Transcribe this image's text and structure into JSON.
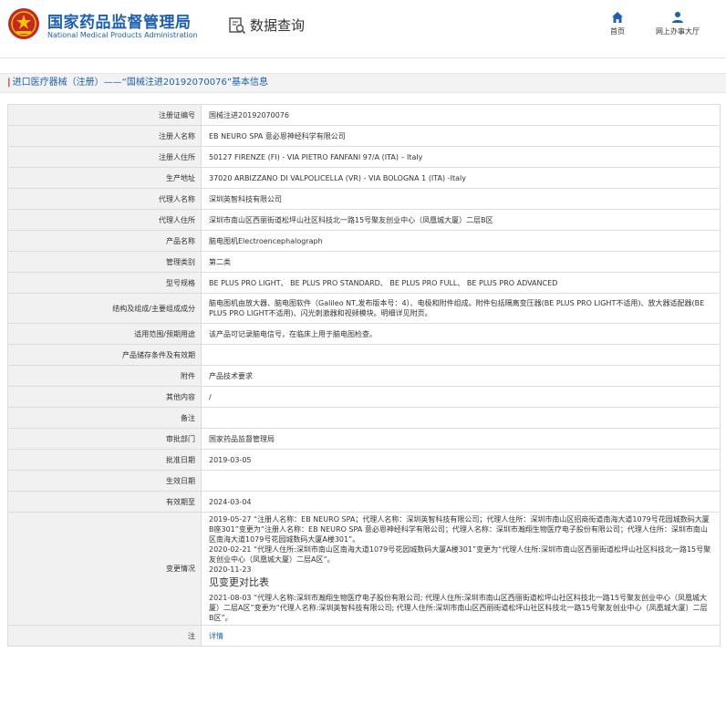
{
  "header": {
    "org_cn": "国家药品监督管理局",
    "org_en": "National Medical Products Administration",
    "query_title": "数据查询",
    "nav": {
      "home": "首页",
      "office": "网上办事大厅"
    },
    "colors": {
      "brand": "#1d5fb0",
      "seal_red": "#c62828"
    }
  },
  "breadcrumb": {
    "text": "进口医疗器械（注册）——“国械注进20192070076”基本信息"
  },
  "rows": [
    {
      "label": "注册证编号",
      "value": "国械注进20192070076"
    },
    {
      "label": "注册人名称",
      "value": "EB NEURO SPA 意必恩神经科学有限公司"
    },
    {
      "label": "注册人住所",
      "value": "50127 FIRENZE (FI) - VIA PIETRO FANFANI 97/A (ITA) – Italy"
    },
    {
      "label": "生产地址",
      "value": "37020 ARBIZZANO DI VALPOLICELLA (VR) - VIA BOLOGNA 1 (ITA) -Italy"
    },
    {
      "label": "代理人名称",
      "value": "深圳英智科技有限公司"
    },
    {
      "label": "代理人住所",
      "value": "深圳市南山区西丽街道松坪山社区科技北一路15号聚友创业中心（凤凰城大厦）二层B区"
    },
    {
      "label": "产品名称",
      "value": "脑电图机Electroencephalograph"
    },
    {
      "label": "管理类别",
      "value": "第二类"
    },
    {
      "label": "型号规格",
      "value": "BE PLUS PRO LIGHT、 BE PLUS PRO STANDARD、 BE PLUS PRO FULL、 BE PLUS PRO ADVANCED"
    },
    {
      "label": "结构及组成/主要组成成分",
      "value": "脑电图机由放大器、脑电图软件（Galileo NT,发布版本号：4）、电极和附件组成。附件包括隔离变压器(BE PLUS PRO LIGHT不适用)、放大器适配器(BE PLUS PRO LIGHT不适用)、闪光刺激器和视频模块。明细详见附页。"
    },
    {
      "label": "适用范围/预期用途",
      "value": "该产品可记录脑电信号，在临床上用于脑电图检查。"
    },
    {
      "label": "产品储存条件及有效期",
      "value": ""
    },
    {
      "label": "附件",
      "value": "产品技术要求"
    },
    {
      "label": "其他内容",
      "value": "/"
    },
    {
      "label": "备注",
      "value": ""
    },
    {
      "label": "审批部门",
      "value": "国家药品监督管理局"
    },
    {
      "label": "批准日期",
      "value": "2019-03-05"
    },
    {
      "label": "生效日期",
      "value": ""
    },
    {
      "label": "有效期至",
      "value": "2024-03-04"
    }
  ],
  "changes": {
    "label": "变更情况",
    "entries": [
      "2019-05-27 “注册人名称：EB NEURO SPA；代理人名称：深圳英智科技有限公司；代理人住所：深圳市南山区招商街道南海大道1079号花园城数码大厦B座301”变更为“注册人名称：EB NEURO SPA 意必恩神经科学有限公司；代理人名称：深圳市瀚翔生物医疗电子股份有限公司；代理人住所：深圳市南山区南海大道1079号花园城数码大厦A楼301”。",
      "2020-02-21 “代理人住所:深圳市南山区南海大道1079号花园城数码大厦A楼301”变更为“代理人住所:深圳市南山区西丽街道松坪山社区科技北一路15号聚友创业中心（凤凰城大厦）二层A区”。",
      "2020-11-23"
    ],
    "see_table": "见变更对比表",
    "last_entry": "2021-08-03 “代理人名称:深圳市瀚翔生物医疗电子股份有限公司; 代理人住所:深圳市南山区西丽街道松坪山社区科技北一路15号聚友创业中心（凤凰城大厦）二层A区”变更为“代理人名称:深圳英智科技有限公司; 代理人住所:深圳市南山区西丽街道松坪山社区科技北一路15号聚友创业中心（凤凰城大厦）二层B区”。"
  },
  "note": {
    "label": "注",
    "link": "详情"
  }
}
